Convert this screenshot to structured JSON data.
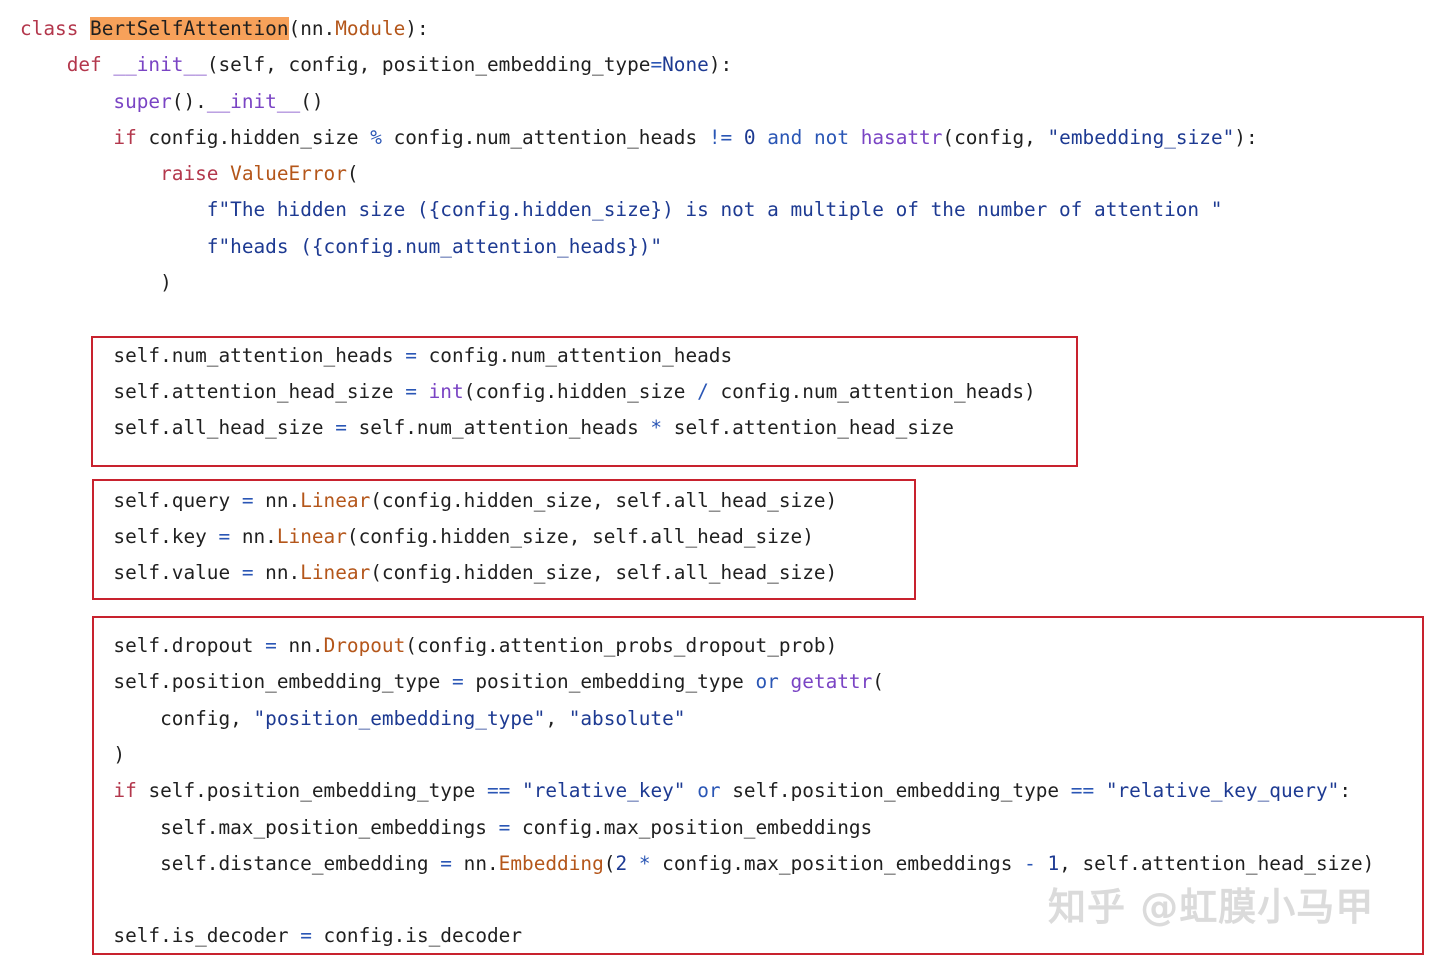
{
  "code_lines": [
    [
      {
        "t": "class ",
        "c": "kw"
      },
      {
        "t": "BertSelfAttention",
        "c": "hl"
      },
      {
        "t": "(nn."
      },
      {
        "t": "Module",
        "c": "ca"
      },
      {
        "t": "):"
      }
    ],
    [
      {
        "t": "    "
      },
      {
        "t": "def ",
        "c": "kw"
      },
      {
        "t": "__init__",
        "c": "bi"
      },
      {
        "t": "(self, config, position_embedding_type"
      },
      {
        "t": "=",
        "c": "op"
      },
      {
        "t": "None",
        "c": "cn"
      },
      {
        "t": "):"
      }
    ],
    [
      {
        "t": "        "
      },
      {
        "t": "super",
        "c": "bi"
      },
      {
        "t": "()."
      },
      {
        "t": "__init__",
        "c": "bi"
      },
      {
        "t": "()"
      }
    ],
    [
      {
        "t": "        "
      },
      {
        "t": "if ",
        "c": "kw"
      },
      {
        "t": "config.hidden_size "
      },
      {
        "t": "%",
        "c": "op"
      },
      {
        "t": " config.num_attention_heads "
      },
      {
        "t": "!=",
        "c": "op"
      },
      {
        "t": " "
      },
      {
        "t": "0",
        "c": "cn"
      },
      {
        "t": " "
      },
      {
        "t": "and",
        "c": "op"
      },
      {
        "t": " "
      },
      {
        "t": "not",
        "c": "op"
      },
      {
        "t": " "
      },
      {
        "t": "hasattr",
        "c": "bi"
      },
      {
        "t": "(config, "
      },
      {
        "t": "\"embedding_size\"",
        "c": "st"
      },
      {
        "t": "):"
      }
    ],
    [
      {
        "t": "            "
      },
      {
        "t": "raise ",
        "c": "kw"
      },
      {
        "t": "ValueError",
        "c": "ca"
      },
      {
        "t": "("
      }
    ],
    [
      {
        "t": "                "
      },
      {
        "t": "f\"The hidden size ({config.hidden_size}) is not a multiple of the number of attention \"",
        "c": "st"
      }
    ],
    [
      {
        "t": "                "
      },
      {
        "t": "f\"heads ({config.num_attention_heads})\"",
        "c": "st"
      }
    ],
    [
      {
        "t": "            )"
      }
    ],
    [
      {
        "t": ""
      }
    ],
    [
      {
        "t": "        self.num_attention_heads "
      },
      {
        "t": "=",
        "c": "op"
      },
      {
        "t": " config.num_attention_heads"
      }
    ],
    [
      {
        "t": "        self.attention_head_size "
      },
      {
        "t": "=",
        "c": "op"
      },
      {
        "t": " "
      },
      {
        "t": "int",
        "c": "bi"
      },
      {
        "t": "(config.hidden_size "
      },
      {
        "t": "/",
        "c": "op"
      },
      {
        "t": " config.num_attention_heads)"
      }
    ],
    [
      {
        "t": "        self.all_head_size "
      },
      {
        "t": "=",
        "c": "op"
      },
      {
        "t": " self.num_attention_heads "
      },
      {
        "t": "*",
        "c": "op"
      },
      {
        "t": " self.attention_head_size"
      }
    ],
    [
      {
        "t": ""
      }
    ],
    [
      {
        "t": "        self.query "
      },
      {
        "t": "=",
        "c": "op"
      },
      {
        "t": " nn."
      },
      {
        "t": "Linear",
        "c": "ca"
      },
      {
        "t": "(config.hidden_size, self.all_head_size)"
      }
    ],
    [
      {
        "t": "        self.key "
      },
      {
        "t": "=",
        "c": "op"
      },
      {
        "t": " nn."
      },
      {
        "t": "Linear",
        "c": "ca"
      },
      {
        "t": "(config.hidden_size, self.all_head_size)"
      }
    ],
    [
      {
        "t": "        self.value "
      },
      {
        "t": "=",
        "c": "op"
      },
      {
        "t": " nn."
      },
      {
        "t": "Linear",
        "c": "ca"
      },
      {
        "t": "(config.hidden_size, self.all_head_size)"
      }
    ],
    [
      {
        "t": ""
      }
    ],
    [
      {
        "t": "        self.dropout "
      },
      {
        "t": "=",
        "c": "op"
      },
      {
        "t": " nn."
      },
      {
        "t": "Dropout",
        "c": "ca"
      },
      {
        "t": "(config.attention_probs_dropout_prob)"
      }
    ],
    [
      {
        "t": "        self.position_embedding_type "
      },
      {
        "t": "=",
        "c": "op"
      },
      {
        "t": " position_embedding_type "
      },
      {
        "t": "or",
        "c": "op"
      },
      {
        "t": " "
      },
      {
        "t": "getattr",
        "c": "bi"
      },
      {
        "t": "("
      }
    ],
    [
      {
        "t": "            config, "
      },
      {
        "t": "\"position_embedding_type\"",
        "c": "st"
      },
      {
        "t": ", "
      },
      {
        "t": "\"absolute\"",
        "c": "st"
      }
    ],
    [
      {
        "t": "        )"
      }
    ],
    [
      {
        "t": "        "
      },
      {
        "t": "if",
        "c": "kw"
      },
      {
        "t": " self.position_embedding_type "
      },
      {
        "t": "==",
        "c": "op"
      },
      {
        "t": " "
      },
      {
        "t": "\"relative_key\"",
        "c": "st"
      },
      {
        "t": " "
      },
      {
        "t": "or",
        "c": "op"
      },
      {
        "t": " self.position_embedding_type "
      },
      {
        "t": "==",
        "c": "op"
      },
      {
        "t": " "
      },
      {
        "t": "\"relative_key_query\"",
        "c": "st"
      },
      {
        "t": ":"
      }
    ],
    [
      {
        "t": "            self.max_position_embeddings "
      },
      {
        "t": "=",
        "c": "op"
      },
      {
        "t": " config.max_position_embeddings"
      }
    ],
    [
      {
        "t": "            self.distance_embedding "
      },
      {
        "t": "=",
        "c": "op"
      },
      {
        "t": " nn."
      },
      {
        "t": "Embedding",
        "c": "ca"
      },
      {
        "t": "("
      },
      {
        "t": "2",
        "c": "cn"
      },
      {
        "t": " "
      },
      {
        "t": "*",
        "c": "op"
      },
      {
        "t": " config.max_position_embeddings "
      },
      {
        "t": "-",
        "c": "op"
      },
      {
        "t": " "
      },
      {
        "t": "1",
        "c": "cn"
      },
      {
        "t": ", self.attention_head_size)"
      }
    ],
    [
      {
        "t": ""
      }
    ],
    [
      {
        "t": "        self.is_decoder "
      },
      {
        "t": "=",
        "c": "op"
      },
      {
        "t": " config.is_decoder"
      }
    ]
  ],
  "colors": {
    "keyword": "#b3374c",
    "builtin": "#7a44c4",
    "class_name": "#b4561a",
    "operator": "#2a56b5",
    "string": "#1d3a92",
    "highlight": "#f7a15a",
    "box_border": "#c8222e"
  },
  "watermark": "知乎 @虹膜小马甲"
}
